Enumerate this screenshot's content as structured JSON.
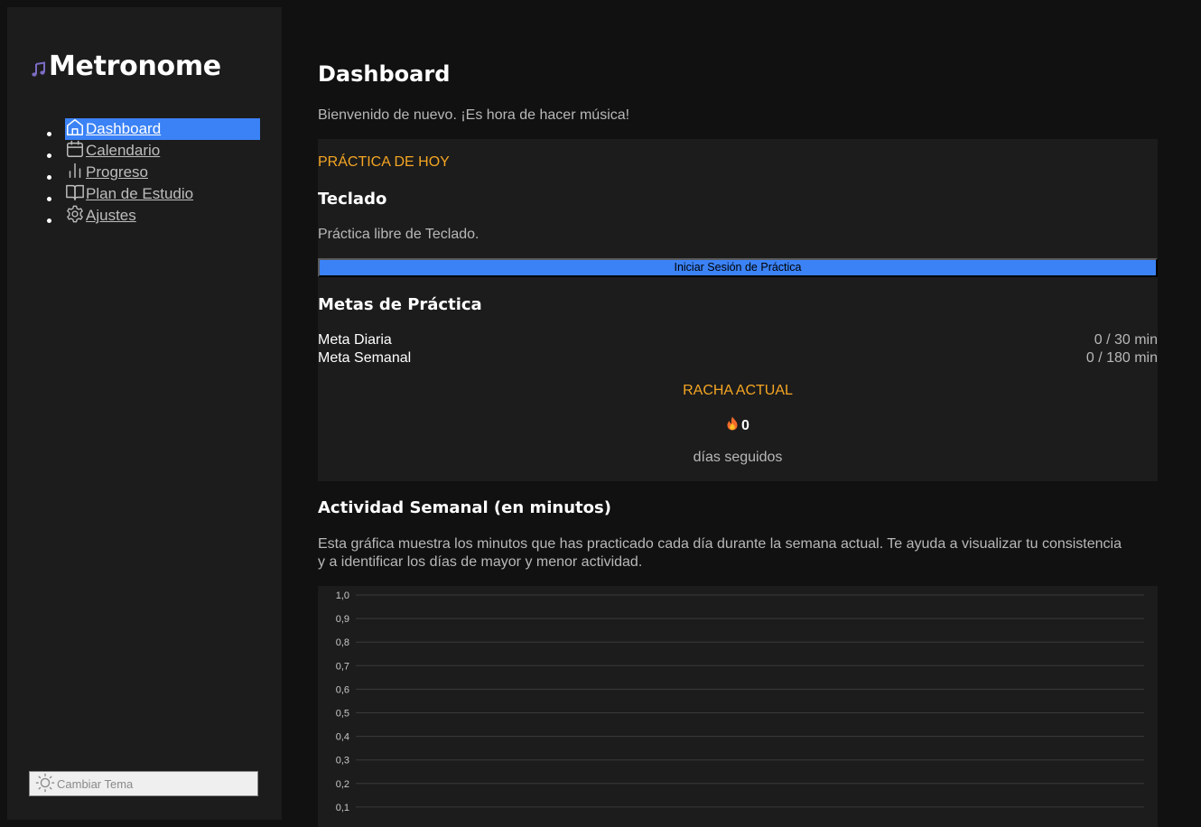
{
  "app": {
    "name": "Metronome",
    "logo_icon": "music-note-icon"
  },
  "sidebar": {
    "items": [
      {
        "label": "Dashboard",
        "icon": "home-icon",
        "active": true
      },
      {
        "label": "Calendario",
        "icon": "calendar-icon",
        "active": false
      },
      {
        "label": "Progreso",
        "icon": "bar-chart-icon",
        "active": false
      },
      {
        "label": "Plan de Estudio",
        "icon": "book-open-icon",
        "active": false
      },
      {
        "label": "Ajustes",
        "icon": "gear-icon",
        "active": false
      }
    ],
    "theme_button": {
      "label": "Cambiar Tema",
      "icon": "sun-icon"
    }
  },
  "main": {
    "title": "Dashboard",
    "welcome": "Bienvenido de nuevo. ¡Es hora de hacer música!",
    "today": {
      "label": "PRÁCTICA DE HOY",
      "instrument": "Teclado",
      "description": "Práctica libre de Teclado.",
      "start_button": "Iniciar Sesión de Práctica"
    },
    "goals": {
      "title": "Metas de Práctica",
      "items": [
        {
          "name": "Meta Diaria",
          "value": "0 / 30 min"
        },
        {
          "name": "Meta Semanal",
          "value": "0 / 180 min"
        }
      ]
    },
    "streak": {
      "label": "RACHA ACTUAL",
      "icon": "flame-icon",
      "value": "0",
      "unit": "días seguidos"
    },
    "activity": {
      "title": "Actividad Semanal (en minutos)",
      "description": "Esta gráfica muestra los minutos que has practicado cada día durante la semana actual. Te ayuda a visualizar tu consistencia y a identificar los días de mayor y menor actividad."
    }
  },
  "colors": {
    "accent": "#3b82f6",
    "highlight": "#f5a623",
    "background": "#111111",
    "panel": "#1c1c1c"
  },
  "chart_data": {
    "type": "bar",
    "series": [],
    "y_ticks": [
      "1,0",
      "0,9",
      "0,8",
      "0,7",
      "0,6",
      "0,5",
      "0,4",
      "0,3",
      "0,2",
      "0,1"
    ],
    "ylim": [
      0,
      1
    ],
    "grid": true
  }
}
